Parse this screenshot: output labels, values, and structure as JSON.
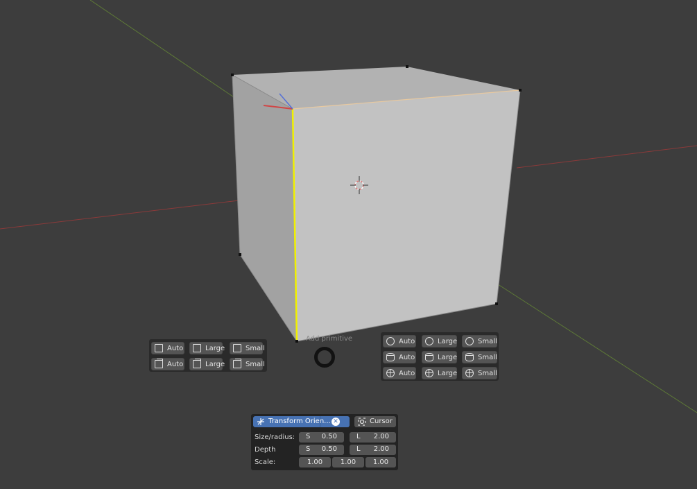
{
  "pie_menu": {
    "title": "Add primitive",
    "left_group": {
      "rows": [
        [
          {
            "icon": "plane-icon",
            "label": "Auto"
          },
          {
            "icon": "plane-icon",
            "label": "Large"
          },
          {
            "icon": "plane-icon",
            "label": "Small"
          }
        ],
        [
          {
            "icon": "cube-icon",
            "label": "Auto"
          },
          {
            "icon": "cube-icon",
            "label": "Large"
          },
          {
            "icon": "cube-icon",
            "label": "Small"
          }
        ]
      ]
    },
    "right_group": {
      "rows": [
        [
          {
            "icon": "circle-icon",
            "label": "Auto"
          },
          {
            "icon": "circle-icon",
            "label": "Large"
          },
          {
            "icon": "circle-icon",
            "label": "Small"
          }
        ],
        [
          {
            "icon": "cylinder-icon",
            "label": "Auto"
          },
          {
            "icon": "cylinder-icon",
            "label": "Large"
          },
          {
            "icon": "cylinder-icon",
            "label": "Small"
          }
        ],
        [
          {
            "icon": "sphere-icon",
            "label": "Auto"
          },
          {
            "icon": "sphere-icon",
            "label": "Large"
          },
          {
            "icon": "sphere-icon",
            "label": "Small"
          }
        ]
      ]
    }
  },
  "operator_panel": {
    "transform_orientation_label": "Transform Orien...",
    "cursor_label": "Cursor",
    "size_radius": {
      "label": "Size/radius:",
      "s_prefix": "S",
      "s_value": "0.50",
      "l_prefix": "L",
      "l_value": "2.00"
    },
    "depth": {
      "label": "Depth",
      "s_prefix": "S",
      "s_value": "0.50",
      "l_prefix": "L",
      "l_value": "2.00"
    },
    "scale": {
      "label": "Scale:",
      "x": "1.00",
      "y": "1.00",
      "z": "1.00"
    }
  },
  "colors": {
    "background": "#3d3d3d",
    "x_axis": "#8b3a3a",
    "y_axis": "#5e7a37",
    "selected_edge": "#f0f000",
    "active_button": "#4772b3"
  }
}
